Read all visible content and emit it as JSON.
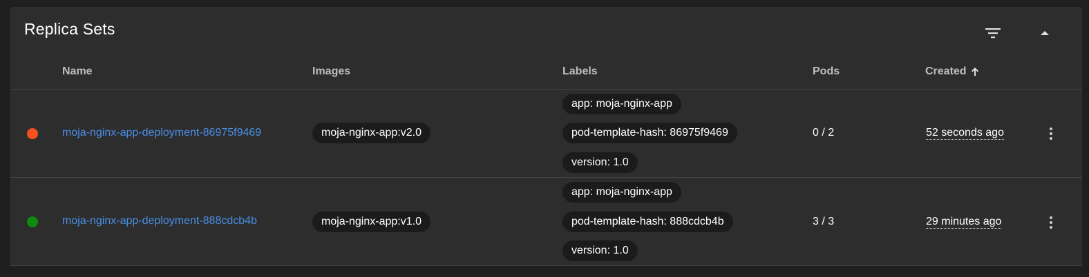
{
  "panel": {
    "title": "Replica Sets",
    "filter_icon": "filter-icon",
    "collapse_icon": "chevron-up-icon"
  },
  "columns": {
    "name": "Name",
    "images": "Images",
    "labels": "Labels",
    "pods": "Pods",
    "created": "Created",
    "sort_icon": "arrow-up-icon"
  },
  "colors": {
    "status_error": "#f4511e",
    "status_ok": "#0f8a0f",
    "link": "#4a8fe8"
  },
  "rows": [
    {
      "status": "error",
      "name": "moja-nginx-app-deployment-86975f9469",
      "image": "moja-nginx-app:v2.0",
      "labels": [
        "app: moja-nginx-app",
        "pod-template-hash: 86975f9469",
        "version: 1.0"
      ],
      "pods": "0 / 2",
      "created": "52 seconds ago",
      "menu_icon": "more-vertical-icon"
    },
    {
      "status": "ok",
      "name": "moja-nginx-app-deployment-888cdcb4b",
      "image": "moja-nginx-app:v1.0",
      "labels": [
        "app: moja-nginx-app",
        "pod-template-hash: 888cdcb4b",
        "version: 1.0"
      ],
      "pods": "3 / 3",
      "created": "29 minutes ago",
      "menu_icon": "more-vertical-icon"
    }
  ]
}
